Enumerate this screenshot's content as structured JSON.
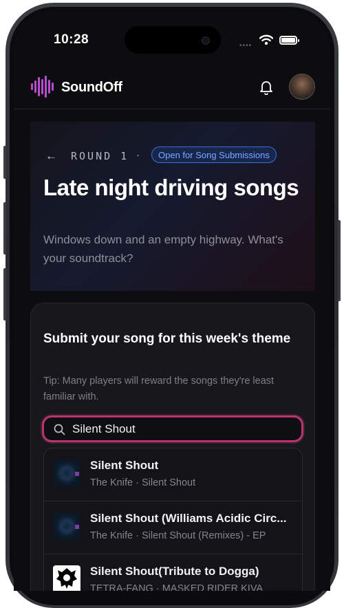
{
  "status_bar": {
    "time": "10:28"
  },
  "app": {
    "brand": "SoundOff",
    "logo_icon": "waveform-logo-icon",
    "bell_icon": "bell-icon",
    "colors": {
      "accent": "#b8356e",
      "badge_text": "#7fa8ff",
      "badge_border": "#3d6fd8",
      "background": "#0d0d10"
    }
  },
  "round": {
    "label": "ROUND 1",
    "separator": "·",
    "badge": "Open for Song Submissions",
    "theme_title": "Late night driving songs",
    "theme_subtitle": "Windows down and an empty highway. What's your soundtrack?"
  },
  "submit": {
    "title": "Submit your song for this week's theme",
    "tip": "Tip: Many players will reward the songs they're least familiar with.",
    "search_value": "Silent Shout"
  },
  "results": [
    {
      "title": "Silent Shout",
      "subtitle": "The Knife · Silent Shout",
      "art": "album-art-knife"
    },
    {
      "title": "Silent Shout (Williams Acidic Circ...",
      "subtitle": "The Knife · Silent Shout (Remixes) - EP",
      "art": "album-art-knife"
    },
    {
      "title": "Silent Shout(Tribute to Dogga)",
      "subtitle": "TETRA-FANG · MASKED RIDER KIVA",
      "art": "album-art-dogga"
    }
  ]
}
